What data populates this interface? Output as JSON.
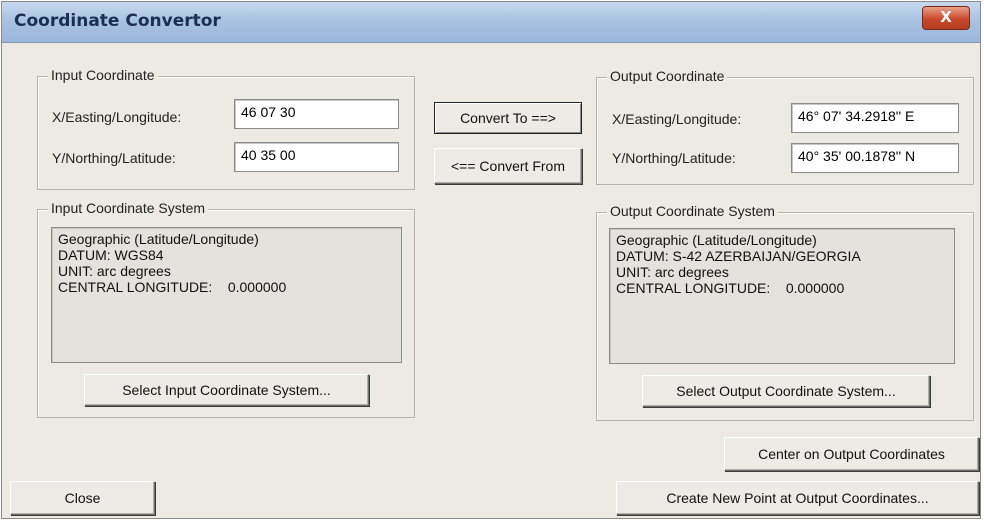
{
  "window": {
    "title": "Coordinate Convertor",
    "close_glyph": "X"
  },
  "input_coordinate": {
    "legend": "Input Coordinate",
    "x_label": "X/Easting/Longitude:",
    "x_value": "46 07 30",
    "y_label": "Y/Northing/Latitude:",
    "y_value": "40 35 00"
  },
  "output_coordinate": {
    "legend": "Output Coordinate",
    "x_label": "X/Easting/Longitude:",
    "x_value": "46° 07' 34.2918'' E",
    "y_label": "Y/Northing/Latitude:",
    "y_value": "40° 35' 00.1878'' N"
  },
  "buttons": {
    "convert_to": "Convert To ==>",
    "convert_from": "<== Convert From",
    "select_input": "Select Input Coordinate System...",
    "select_output": "Select Output Coordinate System...",
    "center_output": "Center on Output Coordinates",
    "close": "Close",
    "create_point": "Create New Point at Output Coordinates..."
  },
  "input_system": {
    "legend": "Input Coordinate System",
    "lines": [
      "Geographic (Latitude/Longitude)",
      "DATUM: WGS84",
      "UNIT: arc degrees",
      "CENTRAL LONGITUDE:    0.000000"
    ]
  },
  "output_system": {
    "legend": "Output Coordinate System",
    "lines": [
      "Geographic (Latitude/Longitude)",
      "DATUM: S-42 AZERBAIJAN/GEORGIA",
      "UNIT: arc degrees",
      "CENTRAL LONGITUDE:    0.000000"
    ]
  }
}
